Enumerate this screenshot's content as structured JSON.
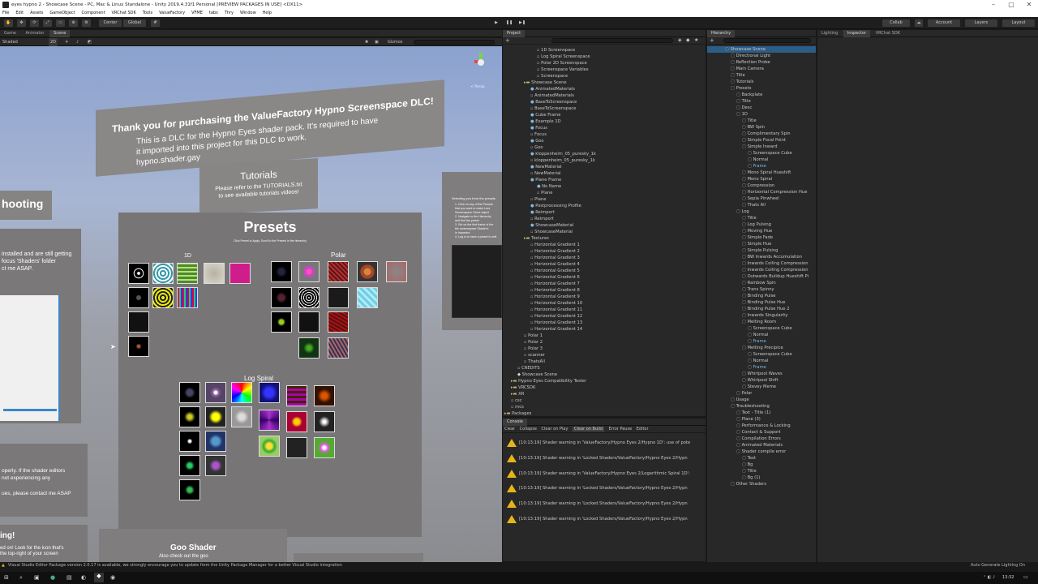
{
  "window": {
    "title": "eyes hypno 2 - Showcase Scene - PC, Mac & Linux Standalone - Unity 2019.4.31f1 Personal [PREVIEW PACKAGES IN USE] <DX11>"
  },
  "menu": [
    "File",
    "Edit",
    "Assets",
    "GameObject",
    "Component",
    "VRChat SDK",
    "Tools",
    "ValueFactory",
    "VFME",
    "tabs",
    "Thry",
    "Window",
    "Help"
  ],
  "toolbar": {
    "center": "Center",
    "global": "Global",
    "collab": "Collab",
    "account": "Account",
    "layers": "Layers",
    "layout": "Layout"
  },
  "scene_tabs": [
    "Game",
    "Animator",
    "Scene"
  ],
  "scene_toolbar": {
    "shading": "Shaded",
    "mode": "2D",
    "gizmos": "Gizmos",
    "gizmos_search": "All"
  },
  "scene": {
    "persp_label": "< Persp",
    "welcome_title": "Thank you for purchasing the ValueFactory Hypno Screenspace DLC!",
    "welcome_body1": "This is a DLC for the Hypno Eyes shader pack. It's required to have",
    "welcome_body2": "it imported into this project for this DLC to work.",
    "welcome_link": "hypno.shader.gay",
    "tutorials_title": "Tutorials",
    "tutorials_body1": "Please refer to the TUTORIALS.txt",
    "tutorials_body2": "to see available tutorials videos!",
    "troubleshooting_title": "hooting",
    "trouble_line1": "installed and are still getting",
    "trouble_line2": "focus 'Shaders' folder",
    "trouble_line3": "ct me ASAP.",
    "lower_line1": "operly. If the shader editors",
    "lower_line2": "not experiencing any",
    "lower_line3": "ues, please contact me ASAP",
    "ing_title": "ing!",
    "ing_line1": "ed on! Look for the icon that's",
    "ing_line2": "the top-right of your screen",
    "presets_title": "Presets",
    "presets_sub": "Click Preset to Apply. Scroll to the Presets in the hierarchy",
    "group_1d": "1D",
    "group_polar": "Polar",
    "group_log": "Log Spiral",
    "goo_title": "Goo Shader",
    "goo_sub": "Also check out the goo",
    "right_card_title": "Selecting you from the presets",
    "right_card_lines": [
      "1. Click on any of the Presets",
      "that you want to make Lure",
      "Screenspace Clone object",
      "2. Navigate to the Hierarchy",
      "and find the preset",
      "3. Set on the first frame of the",
      "the screenspace Shader's",
      "in Inspector",
      "4. Log in to have a preset to edit"
    ]
  },
  "project": {
    "tab": "Project",
    "items": [
      {
        "t": "1D Screenspace",
        "d": 3,
        "i": "asset"
      },
      {
        "t": "Log Spiral Screenspace",
        "d": 3,
        "i": "asset"
      },
      {
        "t": "Polar 2D Screenspace",
        "d": 3,
        "i": "asset"
      },
      {
        "t": "Screenspace Variables",
        "d": 3,
        "i": "asset"
      },
      {
        "t": "Screenspace",
        "d": 3,
        "i": "asset"
      },
      {
        "t": "Showcase Scene",
        "d": 1,
        "i": "folder"
      },
      {
        "t": "AnimatedMaterials",
        "d": 2,
        "i": "mat"
      },
      {
        "t": "AnimatedMaterials",
        "d": 2,
        "i": "asset"
      },
      {
        "t": "BaseToScreenspace",
        "d": 2,
        "i": "mat"
      },
      {
        "t": "BaseToScreenspace",
        "d": 2,
        "i": "asset"
      },
      {
        "t": "Cube Frame",
        "d": 2,
        "i": "mat"
      },
      {
        "t": "Example 1D",
        "d": 2,
        "i": "mat"
      },
      {
        "t": "Focus",
        "d": 2,
        "i": "mat"
      },
      {
        "t": "Focus",
        "d": 2,
        "i": "asset"
      },
      {
        "t": "Goo",
        "d": 2,
        "i": "mat"
      },
      {
        "t": "Goo",
        "d": 2,
        "i": "asset"
      },
      {
        "t": "kloppenheim_05_puresky_1k",
        "d": 2,
        "i": "mat"
      },
      {
        "t": "kloppenheim_05_puresky_1k",
        "d": 2,
        "i": "asset"
      },
      {
        "t": "NewMaterial",
        "d": 2,
        "i": "mat"
      },
      {
        "t": "NewMaterial",
        "d": 2,
        "i": "asset"
      },
      {
        "t": "Plane Frame",
        "d": 2,
        "i": "mat"
      },
      {
        "t": "No Name",
        "d": 3,
        "i": "mat"
      },
      {
        "t": "Plane",
        "d": 3,
        "i": "asset"
      },
      {
        "t": "Plane",
        "d": 2,
        "i": "asset"
      },
      {
        "t": "Postprocessing Profile",
        "d": 2,
        "i": "mat"
      },
      {
        "t": "Reimport",
        "d": 2,
        "i": "mat"
      },
      {
        "t": "Reimport",
        "d": 2,
        "i": "asset"
      },
      {
        "t": "ShowcaseMaterial",
        "d": 2,
        "i": "mat"
      },
      {
        "t": "ShowcaseMaterial",
        "d": 2,
        "i": "asset"
      },
      {
        "t": "Textures",
        "d": 1,
        "i": "folder"
      },
      {
        "t": "Horizontal Gradient 1",
        "d": 2,
        "i": "asset"
      },
      {
        "t": "Horizontal Gradient 2",
        "d": 2,
        "i": "asset"
      },
      {
        "t": "Horizontal Gradient 3",
        "d": 2,
        "i": "asset"
      },
      {
        "t": "Horizontal Gradient 4",
        "d": 2,
        "i": "asset"
      },
      {
        "t": "Horizontal Gradient 5",
        "d": 2,
        "i": "asset"
      },
      {
        "t": "Horizontal Gradient 6",
        "d": 2,
        "i": "asset"
      },
      {
        "t": "Horizontal Gradient 7",
        "d": 2,
        "i": "asset"
      },
      {
        "t": "Horizontal Gradient 8",
        "d": 2,
        "i": "asset"
      },
      {
        "t": "Horizontal Gradient 9",
        "d": 2,
        "i": "asset"
      },
      {
        "t": "Horizontal Gradient 10",
        "d": 2,
        "i": "asset"
      },
      {
        "t": "Horizontal Gradient 11",
        "d": 2,
        "i": "asset"
      },
      {
        "t": "Horizontal Gradient 12",
        "d": 2,
        "i": "asset"
      },
      {
        "t": "Horizontal Gradient 13",
        "d": 2,
        "i": "asset"
      },
      {
        "t": "Horizontal Gradient 14",
        "d": 2,
        "i": "asset"
      },
      {
        "t": "Polar 1",
        "d": 1,
        "i": "asset"
      },
      {
        "t": "Polar 2",
        "d": 1,
        "i": "asset"
      },
      {
        "t": "Polar 3",
        "d": 1,
        "i": "asset"
      },
      {
        "t": "scanner",
        "d": 1,
        "i": "asset"
      },
      {
        "t": "ThatsAll",
        "d": 1,
        "i": "asset"
      },
      {
        "t": "CREDITS",
        "d": 0,
        "i": "asset"
      },
      {
        "t": "Showcase Scene",
        "d": 0,
        "i": "scene"
      },
      {
        "t": "Hypno Eyes Compatibility Tester",
        "d": -1,
        "i": "folder"
      },
      {
        "t": "VRCSDK",
        "d": -1,
        "i": "folder"
      },
      {
        "t": "XR",
        "d": -1,
        "i": "folder"
      },
      {
        "t": "csc",
        "d": -1,
        "i": "asset"
      },
      {
        "t": "mcs",
        "d": -1,
        "i": "asset"
      },
      {
        "t": "Packages",
        "d": -2,
        "i": "folder"
      }
    ]
  },
  "console": {
    "tab": "Console",
    "buttons": [
      "Clear",
      "Collapse",
      "Clear on Play",
      "Clear on Build",
      "Error Pause",
      "Editor"
    ],
    "rows": [
      "[10:13:19] Shader warning in 'ValueFactory/Hypno Eyes 2/Hypno 1D': use of pote",
      "[10:13:19] Shader warning in 'Locked Shaders/ValueFactory/Hypno Eyes 2/Hypn",
      "[10:13:19] Shader warning in 'ValueFactory/Hypno Eyes 2/Logarithmic Spiral 1D':",
      "[10:13:19] Shader warning in 'Locked Shaders/ValueFactory/Hypno Eyes 2/Hypn",
      "[10:13:19] Shader warning in 'Locked Shaders/ValueFactory/Hypno Eyes 2/Hypn",
      "[10:13:19] Shader warning in 'Locked Shaders/ValueFactory/Hypno Eyes 2/Hypn"
    ]
  },
  "hierarchy": {
    "tab": "Hierarchy",
    "items": [
      {
        "t": "Showcase Scene",
        "d": 0,
        "sel": true
      },
      {
        "t": "Directional Light",
        "d": 1
      },
      {
        "t": "Reflection Probe",
        "d": 1
      },
      {
        "t": "Main Camera",
        "d": 1
      },
      {
        "t": "Title",
        "d": 1
      },
      {
        "t": "Tutorials",
        "d": 1
      },
      {
        "t": "Presets",
        "d": 1
      },
      {
        "t": "Backplate",
        "d": 2
      },
      {
        "t": "Title",
        "d": 2
      },
      {
        "t": "Desc",
        "d": 2
      },
      {
        "t": "1D",
        "d": 2
      },
      {
        "t": "Title",
        "d": 3
      },
      {
        "t": "BW Spin",
        "d": 3
      },
      {
        "t": "Complimentary Spin",
        "d": 3
      },
      {
        "t": "Simple Focal Point",
        "d": 3
      },
      {
        "t": "Simple Inward",
        "d": 3
      },
      {
        "t": "Screenspace Cube",
        "d": 4
      },
      {
        "t": "Normal",
        "d": 4
      },
      {
        "t": "Frame",
        "d": 4,
        "blue": true
      },
      {
        "t": "Mono Spiral Hueshift",
        "d": 3
      },
      {
        "t": "Mono Spiral",
        "d": 3
      },
      {
        "t": "Compression",
        "d": 3
      },
      {
        "t": "Horizontal Compression Hue",
        "d": 3
      },
      {
        "t": "Sepia Pinwheel",
        "d": 3
      },
      {
        "t": "Thats All",
        "d": 3
      },
      {
        "t": "Log",
        "d": 2
      },
      {
        "t": "Title",
        "d": 3
      },
      {
        "t": "Log Pulsing",
        "d": 3
      },
      {
        "t": "Moving Hue",
        "d": 3
      },
      {
        "t": "Simple Fade",
        "d": 3
      },
      {
        "t": "Simple Hue",
        "d": 3
      },
      {
        "t": "Simple Pulsing",
        "d": 3
      },
      {
        "t": "BW Inwards Accumulation",
        "d": 3
      },
      {
        "t": "Inwards Coiling Compression",
        "d": 3
      },
      {
        "t": "Inwards Coiling Compression",
        "d": 3
      },
      {
        "t": "Outwards Buildup Hueshift Pi",
        "d": 3
      },
      {
        "t": "Rainbow Spin",
        "d": 3
      },
      {
        "t": "Trans Spinny",
        "d": 3
      },
      {
        "t": "Binding Pulse",
        "d": 3
      },
      {
        "t": "Binding Pulse Hue",
        "d": 3
      },
      {
        "t": "Binding Pulse Hue 2",
        "d": 3
      },
      {
        "t": "Inwards Singularity",
        "d": 3
      },
      {
        "t": "Melting Room",
        "d": 3
      },
      {
        "t": "Screenspace Cube",
        "d": 4
      },
      {
        "t": "Normal",
        "d": 4
      },
      {
        "t": "Frame",
        "d": 4,
        "blue": true
      },
      {
        "t": "Melting Precipice",
        "d": 3
      },
      {
        "t": "Screenspace Cube",
        "d": 4
      },
      {
        "t": "Normal",
        "d": 4
      },
      {
        "t": "Frame",
        "d": 4,
        "blue": true
      },
      {
        "t": "Whirlpool Waves",
        "d": 3
      },
      {
        "t": "Whirlpool Shift",
        "d": 3
      },
      {
        "t": "Stevey Meme",
        "d": 3
      },
      {
        "t": "Polar",
        "d": 2
      },
      {
        "t": "Usage",
        "d": 1
      },
      {
        "t": "Troubleshooting",
        "d": 1
      },
      {
        "t": "Text - Title (1)",
        "d": 2
      },
      {
        "t": "Plane (3)",
        "d": 2
      },
      {
        "t": "Performance & Locking",
        "d": 2
      },
      {
        "t": "Contact & Support",
        "d": 2
      },
      {
        "t": "Compilation Errors",
        "d": 2
      },
      {
        "t": "Animated Materials",
        "d": 2
      },
      {
        "t": "Shader compile error",
        "d": 2
      },
      {
        "t": "Text",
        "d": 3
      },
      {
        "t": "Bg",
        "d": 3
      },
      {
        "t": "Title",
        "d": 3
      },
      {
        "t": "Bg (1)",
        "d": 3
      },
      {
        "t": "Other Shaders",
        "d": 1
      }
    ]
  },
  "inspector_tabs": [
    "Lighting",
    "Inspector",
    "VRChat SDK"
  ],
  "statusbar": {
    "message": "Visual Studio Editor Package version 2.0.17 is available, we strongly encourage you to update from the Unity Package Manager for a better Visual Studio integration",
    "right": "Auto Generate Lighting On"
  },
  "taskbar": {
    "time": "13:32"
  },
  "colors": {
    "accent": "#2c5d87",
    "warning": "#e8b518",
    "scene_card": "#7e7c7c"
  }
}
